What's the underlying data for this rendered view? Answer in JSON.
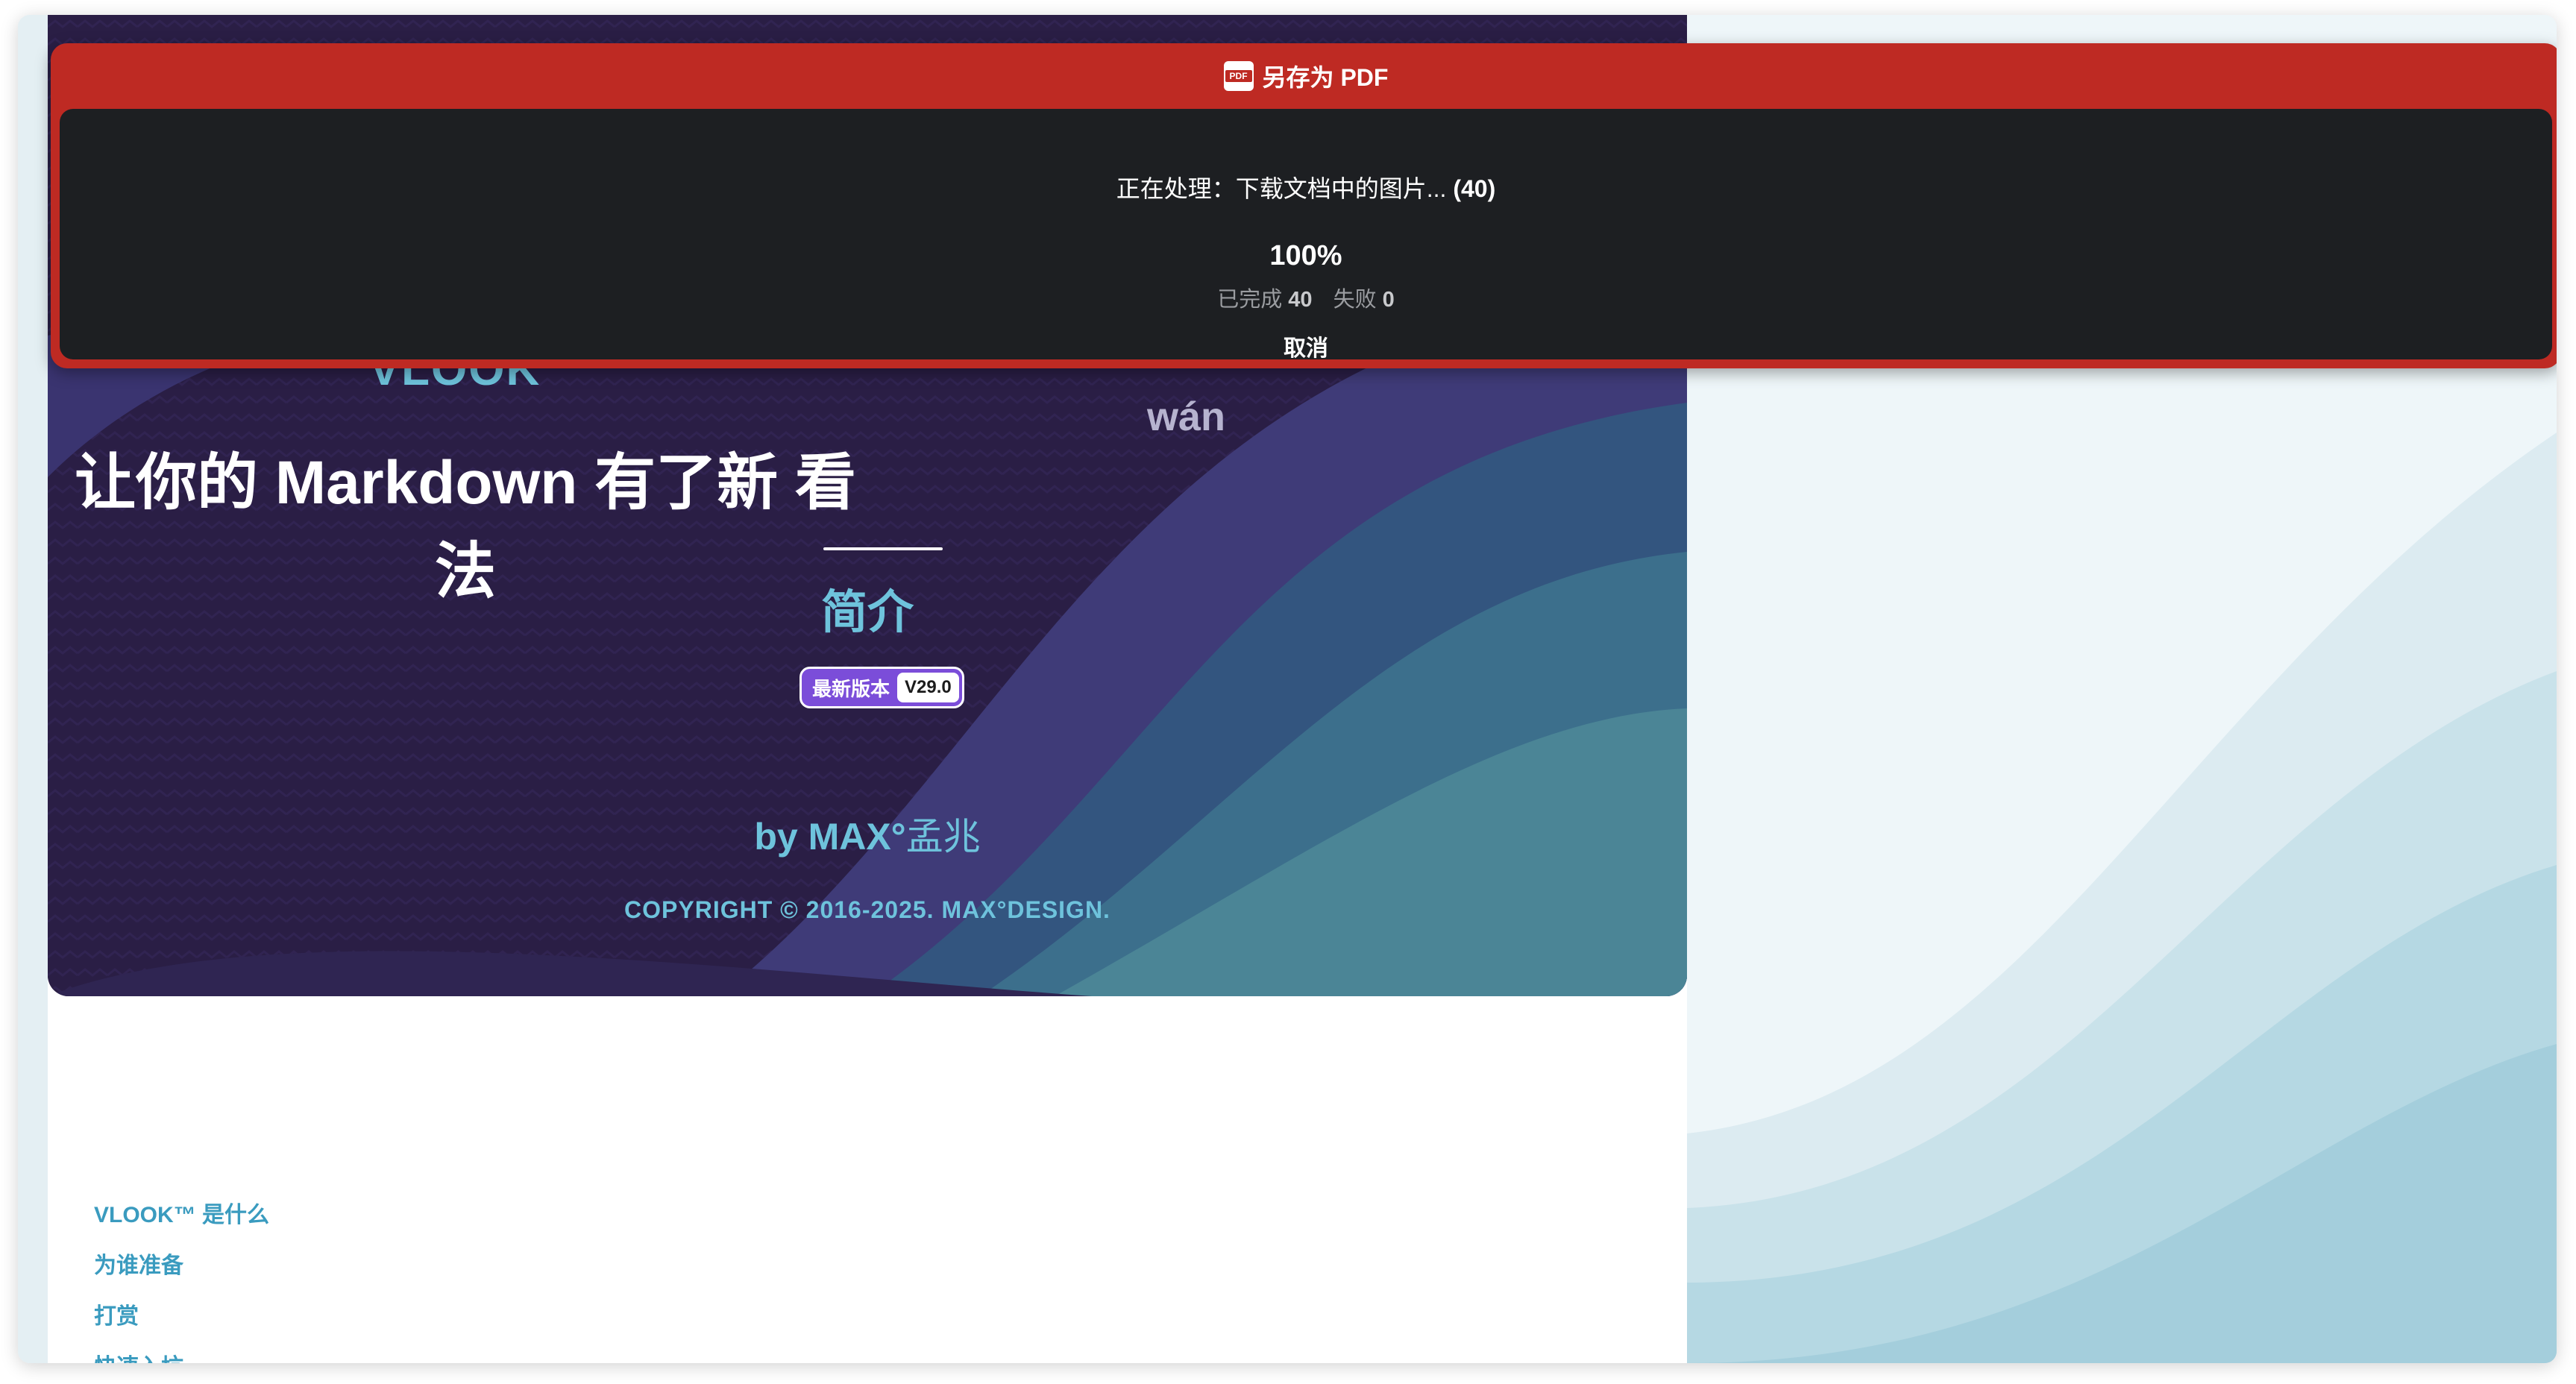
{
  "dialog": {
    "title": "另存为 PDF",
    "pdf_icon_text": "PDF",
    "status_prefix": "正在处理：下载文档中的图片...",
    "status_count": "(40)",
    "percent": "100%",
    "completed_label": "已完成",
    "completed_value": "40",
    "failed_label": "失败",
    "failed_value": "0",
    "cancel_label": "取消",
    "progress": 1.0
  },
  "cover": {
    "logo": "VLOOK",
    "logo_tm": "™",
    "slogan": "让你的 Markdown 有了新 看 法",
    "pinyin": "wán",
    "subtitle": "简介",
    "badge_label": "最新版本",
    "badge_value": "V29.0",
    "byline_prefix": "by",
    "byline_name": "MAX°",
    "byline_cn": "孟兆",
    "copyright": "COPYRIGHT © 2016-2025. MAX°DESIGN."
  },
  "toc": {
    "items": [
      "VLOOK™ 是什么",
      "为谁准备",
      "打赏",
      "快速入坑"
    ]
  },
  "colors": {
    "dialog_header": "#be2a23",
    "dialog_body": "#1d1f22",
    "accent": "#6ec3dc",
    "badge": "#7b4dd9",
    "cover_bg": "#2a1e45"
  }
}
